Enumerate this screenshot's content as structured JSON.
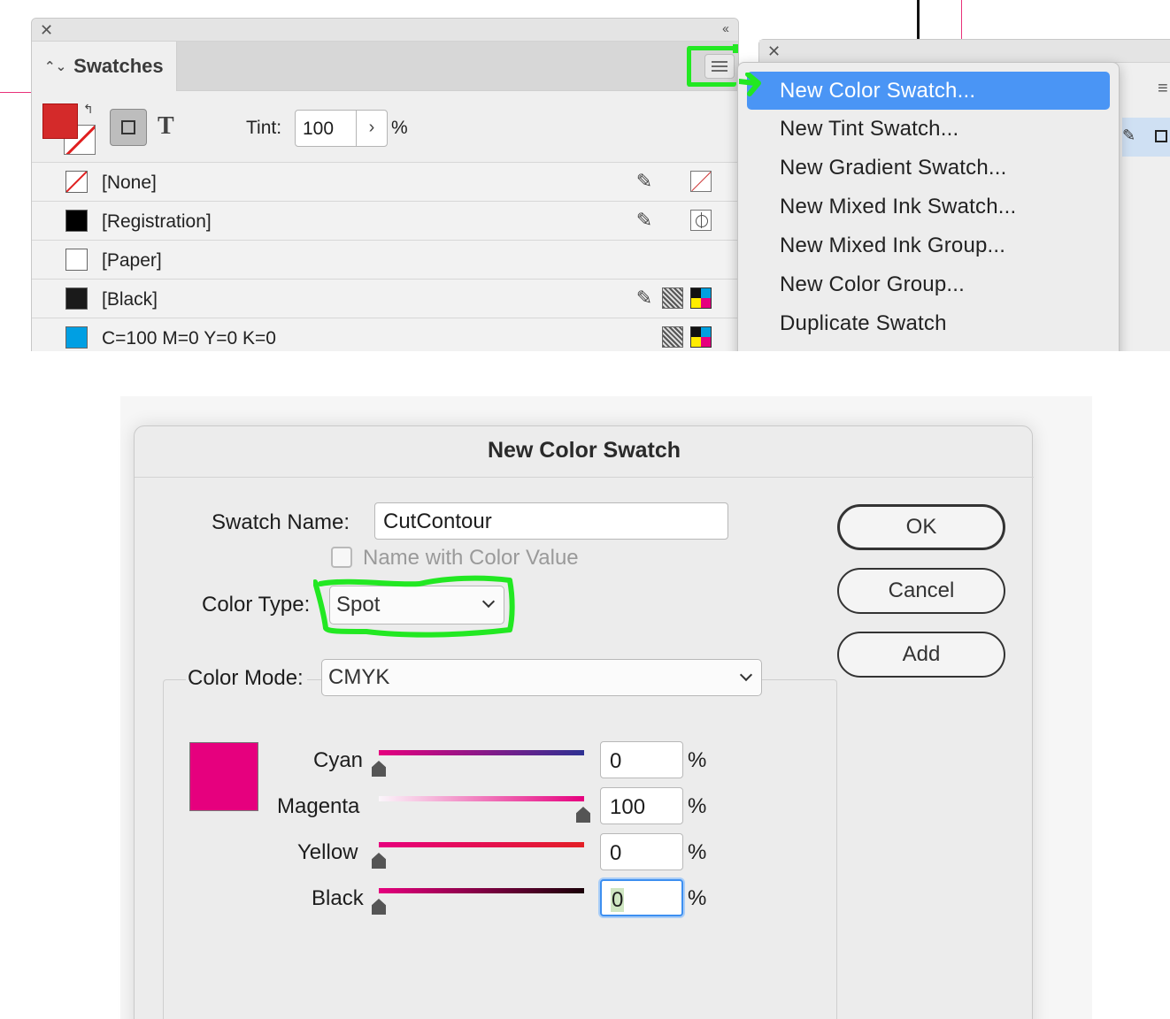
{
  "swatches_panel": {
    "close": "✕",
    "collapse": "‹‹",
    "tab_label": "Swatches",
    "tint_label": "Tint:",
    "tint_value": "100",
    "tint_unit": "%",
    "text_mode_glyph": "T",
    "fill_color": "#d42a2a",
    "rows": [
      {
        "name": "[None]",
        "chip": "none"
      },
      {
        "name": "[Registration]",
        "chip": "#000000"
      },
      {
        "name": "[Paper]",
        "chip": "#ffffff"
      },
      {
        "name": "[Black]",
        "chip": "#1a1a1a"
      },
      {
        "name": "C=100 M=0 Y=0 K=0",
        "chip": "#009fe3"
      }
    ]
  },
  "second_panel": {
    "close": "✕",
    "collapse": "‹‹"
  },
  "panel_menu": {
    "items": [
      "New Color Swatch...",
      "New Tint Swatch...",
      "New Gradient Swatch...",
      "New Mixed Ink Swatch...",
      "New Mixed Ink Group...",
      "New Color Group...",
      "Duplicate Swatch"
    ],
    "active_index": 0,
    "highlight_color": "#4a95f5",
    "annotation_color": "#22e822"
  },
  "dialog": {
    "title": "New Color Swatch",
    "swatch_name_label": "Swatch Name:",
    "swatch_name_value": "CutContour",
    "name_with_value_label": "Name with Color Value",
    "color_type_label": "Color Type:",
    "color_type_value": "Spot",
    "color_mode_label": "Color Mode:",
    "color_mode_value": "CMYK",
    "ok_label": "OK",
    "cancel_label": "Cancel",
    "add_label": "Add",
    "preview_color": "#e6007e",
    "channels": [
      {
        "label": "Cyan",
        "value": "0",
        "unit": "%",
        "level": 0
      },
      {
        "label": "Magenta",
        "value": "100",
        "unit": "%",
        "level": 1
      },
      {
        "label": "Yellow",
        "value": "0",
        "unit": "%",
        "level": 0
      },
      {
        "label": "Black",
        "value": "0",
        "unit": "%",
        "level": 0
      }
    ]
  }
}
